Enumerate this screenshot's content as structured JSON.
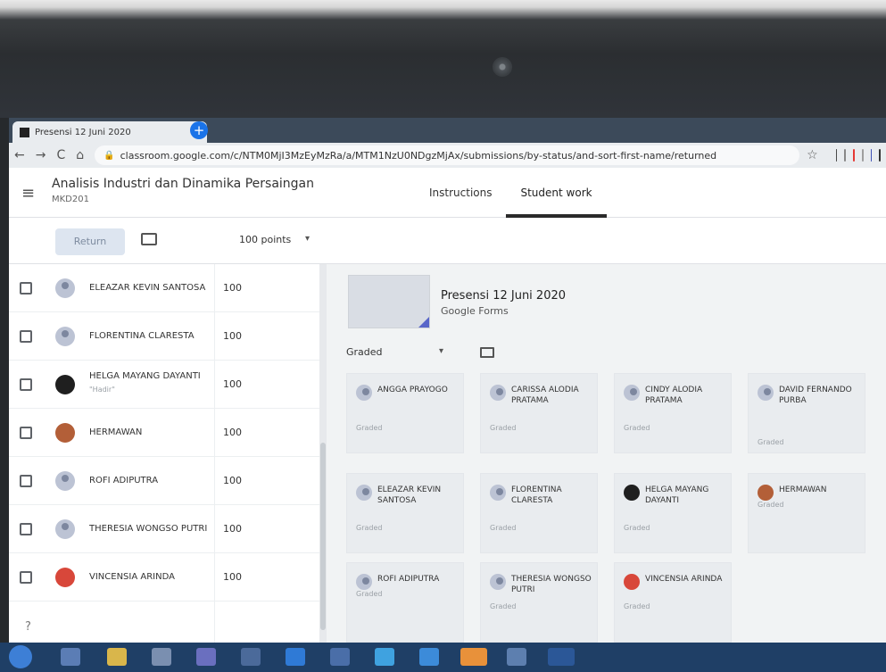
{
  "browser": {
    "tab_title": "Presensi 12 Juni 2020",
    "tab_close": "×",
    "new_tab": "+",
    "url": "classroom.google.com/c/NTM0MjI3MzEyMzRa/a/MTM1NzU0NDgzMjAx/submissions/by-status/and-sort-first-name/returned",
    "nav_back": "←",
    "nav_forward": "→",
    "nav_reload": "C",
    "nav_home": "⌂",
    "lock": "🔒",
    "star": "☆"
  },
  "header": {
    "menu": "≡",
    "course_title": "Analisis Industri dan Dinamika Persaingan",
    "course_code": "MKD201",
    "tabs": [
      "Instructions",
      "Student work"
    ]
  },
  "toolbar": {
    "return_label": "Return",
    "points": "100 points",
    "points_caret": "▾"
  },
  "students": [
    {
      "name": "ELEAZAR KEVIN SANTOSA",
      "score": "100",
      "sub": "",
      "avatar": "default"
    },
    {
      "name": "FLORENTINA CLARESTA",
      "score": "100",
      "sub": "",
      "avatar": "default"
    },
    {
      "name": "HELGA MAYANG DAYANTI",
      "score": "100",
      "sub": "\"Hadir\"",
      "avatar": "dark"
    },
    {
      "name": "HERMAWAN",
      "score": "100",
      "sub": "",
      "avatar": "brown"
    },
    {
      "name": "ROFI ADIPUTRA",
      "score": "100",
      "sub": "",
      "avatar": "default"
    },
    {
      "name": "THERESIA WONGSO PUTRI",
      "score": "100",
      "sub": "",
      "avatar": "default"
    },
    {
      "name": "VINCENSIA ARINDA",
      "score": "100",
      "sub": "",
      "avatar": "red"
    }
  ],
  "assignment": {
    "title": "Presensi 12 Juni 2020",
    "type": "Google Forms"
  },
  "filter": {
    "label": "Graded",
    "caret": "▾"
  },
  "grid": [
    {
      "name": "ANGGA PRAYOGO",
      "status": "Graded",
      "avatar": "default"
    },
    {
      "name": "CARISSA ALODIA PRATAMA",
      "status": "Graded",
      "avatar": "default"
    },
    {
      "name": "CINDY ALODIA PRATAMA",
      "status": "Graded",
      "avatar": "default"
    },
    {
      "name": "DAVID FERNANDO PURBA",
      "status": "Graded",
      "avatar": "default"
    },
    {
      "name": "ELEAZAR KEVIN SANTOSA",
      "status": "Graded",
      "avatar": "default"
    },
    {
      "name": "FLORENTINA CLARESTA",
      "status": "Graded",
      "avatar": "default"
    },
    {
      "name": "HELGA MAYANG DAYANTI",
      "status": "Graded",
      "avatar": "dark"
    },
    {
      "name": "HERMAWAN",
      "status": "Graded",
      "avatar": "brown"
    },
    {
      "name": "ROFI ADIPUTRA",
      "status": "Graded",
      "avatar": "default"
    },
    {
      "name": "THERESIA WONGSO PUTRI",
      "status": "Graded",
      "avatar": "default"
    },
    {
      "name": "VINCENSIA ARINDA",
      "status": "Graded",
      "avatar": "red"
    }
  ],
  "help": "?",
  "colors": {
    "tabstrip": "#3c4a5a",
    "accent": "#1a73e8",
    "taskbar": "#1f3f66"
  }
}
